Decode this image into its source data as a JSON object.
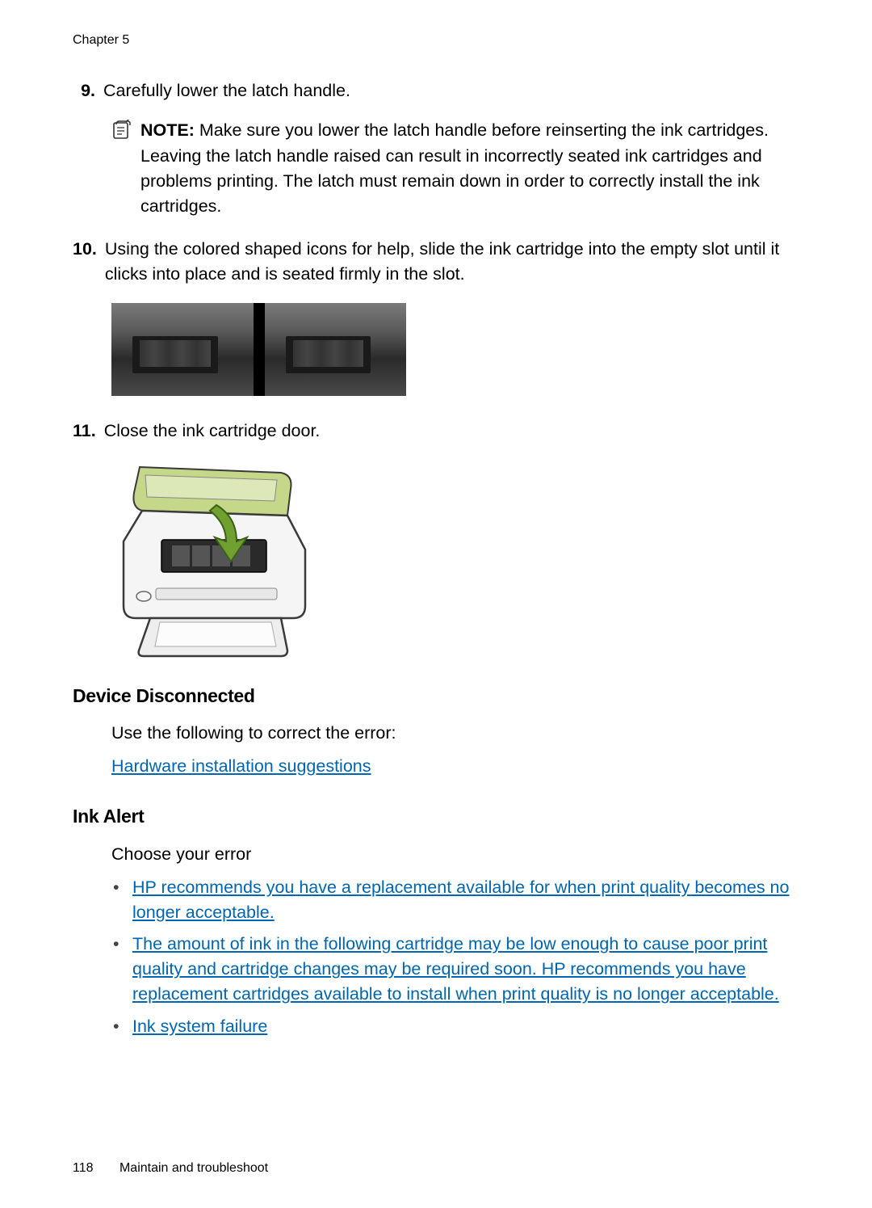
{
  "header": {
    "chapter": "Chapter 5"
  },
  "steps": {
    "s9": {
      "num": "9.",
      "text": "Carefully lower the latch handle."
    },
    "note": {
      "label": "NOTE:",
      "text": "Make sure you lower the latch handle before reinserting the ink cartridges. Leaving the latch handle raised can result in incorrectly seated ink cartridges and problems printing. The latch must remain down in order to correctly install the ink cartridges."
    },
    "s10": {
      "num": "10.",
      "text": "Using the colored shaped icons for help, slide the ink cartridge into the empty slot until it clicks into place and is seated firmly in the slot."
    },
    "s11": {
      "num": "11.",
      "text": "Close the ink cartridge door."
    }
  },
  "sections": {
    "device_disconnected": {
      "heading": "Device Disconnected",
      "intro": "Use the following to correct the error:",
      "link": "Hardware installation suggestions"
    },
    "ink_alert": {
      "heading": "Ink Alert",
      "intro": "Choose your error",
      "bullets": [
        "HP recommends you have a replacement available for when print quality becomes no longer acceptable.",
        "The amount of ink in the following cartridge may be low enough to cause poor print quality and cartridge changes may be required soon. HP recommends you have replacement cartridges available to install when print quality is no longer acceptable.",
        "Ink system failure"
      ]
    }
  },
  "footer": {
    "page": "118",
    "section": "Maintain and troubleshoot"
  }
}
